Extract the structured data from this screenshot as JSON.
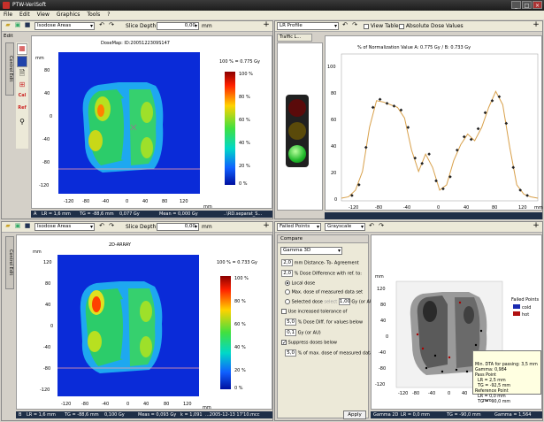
{
  "app": {
    "title": "PTW-VeriSoft"
  },
  "menu": [
    "File",
    "Edit",
    "View",
    "Graphics",
    "Tools",
    "?"
  ],
  "top_left": {
    "mode_select": "Isodose Areas",
    "slice_depth_label": "Slice Depth",
    "slice_depth_value": "0,00",
    "slice_depth_unit": "mm",
    "side_label": "Edit",
    "side_tab": "Control Edit",
    "plot_title": "DoseMap: ID:2005122309S147",
    "y_label": "mm",
    "x_label": "mm",
    "x_ticks": [
      "-120",
      "-80",
      "-40",
      "0",
      "40",
      "80",
      "120"
    ],
    "y_ticks": [
      "80",
      "40",
      "0",
      "-40",
      "-80",
      "-120"
    ],
    "colorbar_header": "100 % = 0.775 Gy",
    "colorbar_ticks": [
      "100 %",
      "80 %",
      "60 %",
      "40 %",
      "20 %",
      "0 %"
    ],
    "status": {
      "a": "A",
      "lr": "LR = 1,6 mm",
      "tg": "TG = -88,6 mm",
      "dose": "0,077 Gy",
      "mean": "Mean = 0,000 Gy",
      "file": "..\\RD.separat_S..."
    }
  },
  "top_right": {
    "mode_select": "LR Profile",
    "view_table": "View Table",
    "absolute": "Absolute Dose Values",
    "traffic_label": "Traffic L...",
    "plot_title": "% of Normalization Value A: 0.775 Gy / B: 0.733 Gy",
    "x_ticks": [
      "-120",
      "-80",
      "-40",
      "0",
      "40",
      "80",
      "120"
    ],
    "y_ticks": [
      "100",
      "80",
      "60",
      "40",
      "20",
      "0"
    ],
    "x_label": "mm"
  },
  "bottom_left": {
    "mode_select": "Isodose Areas",
    "slice_depth_label": "Slice Depth",
    "slice_depth_value": "0,00",
    "slice_depth_unit": "mm",
    "side_tab": "Control Edit",
    "plot_title": "2D-ARRAY",
    "y_label": "mm",
    "x_label": "mm",
    "x_ticks": [
      "-120",
      "-80",
      "-40",
      "0",
      "40",
      "80",
      "120"
    ],
    "y_ticks": [
      "120",
      "80",
      "40",
      "0",
      "-40",
      "-80",
      "-120"
    ],
    "colorbar_header": "100 % = 0.733 Gy",
    "colorbar_ticks": [
      "100 %",
      "80 %",
      "60 %",
      "40 %",
      "20 %",
      "0 %"
    ],
    "status": {
      "b": "B",
      "lr": "LR = 1,6 mm",
      "tg": "TG = -88,6 mm",
      "dose": "0,100 Gy",
      "meas": "Meas = 0,093 Gy",
      "k": "k = 1,091",
      "file": "...2005-12-13 17'10.mcc"
    }
  },
  "bottom_right": {
    "mode_select": "Failed Points",
    "scale_select": "Grayscale",
    "compare_tab": "Compare",
    "method": "Gamma 3D",
    "distance_value": "2,0",
    "distance_label": "mm Distance- To- Agreement",
    "dose_diff_value": "2,0",
    "dose_diff_label": "% Dose Difference with ref. to:",
    "local_dose": "Local dose",
    "max_dose": "Max. dose of measured data set",
    "selected_dose": "Selected dose",
    "select_btn": "select",
    "selected_value": "1,00",
    "selected_unit": "Gy (or AU)",
    "increased_tol": "Use increased tolerance of",
    "inc_pct_value": "5,0",
    "inc_pct_label": "% Dose Diff. for values below",
    "inc_gy_value": "0,1",
    "inc_gy_label": "Gy (or AU)",
    "suppress": "Suppress doses below",
    "suppress_value": "5,0",
    "suppress_label": "% of max. dose of measured data set",
    "apply": "Apply",
    "legend_title": "Failed Points",
    "legend_cold": "cold",
    "legend_hot": "hot",
    "y_label": "mm",
    "x_label": "mm",
    "x_ticks": [
      "-120",
      "-80",
      "-40",
      "0",
      "40",
      "80",
      "120"
    ],
    "y_ticks": [
      "120",
      "80",
      "40",
      "0",
      "-40",
      "-80",
      "-120"
    ],
    "tooltip": [
      "Min. DTA for passing: 3,5 mm",
      "Gamma: 0,984",
      "Pass Point",
      "  LR = 2,5 mm",
      "  TG = -92,5 mm",
      "Reference Point",
      "  LR = 0,0 mm",
      "  TG = -90,0 mm"
    ],
    "status": {
      "g": "Gamma 2D",
      "lr": "LR = 0,0 mm",
      "tg": "TG = -90,0 mm",
      "gamma": "Gamma = 1,564"
    }
  },
  "chart_data": {
    "type": "line",
    "title": "% of Normalization Value A: 0.775 Gy / B: 0.733 Gy",
    "xlabel": "mm",
    "ylabel": "",
    "xlim": [
      -140,
      140
    ],
    "ylim": [
      0,
      110
    ],
    "series": [
      {
        "x": [
          -140,
          -130,
          -120,
          -110,
          -100,
          -90,
          -80,
          -70,
          -60,
          -50,
          -40,
          -30,
          -20,
          -10,
          0,
          10,
          20,
          30,
          40,
          50,
          60,
          70,
          80,
          90,
          100,
          110,
          120,
          130,
          140
        ],
        "values": [
          2,
          3,
          8,
          22,
          55,
          75,
          74,
          72,
          70,
          62,
          38,
          22,
          35,
          25,
          8,
          12,
          30,
          42,
          50,
          45,
          55,
          70,
          82,
          72,
          40,
          12,
          5,
          3,
          2
        ]
      },
      {
        "x": [
          -125,
          -115,
          -105,
          -95,
          -85,
          -75,
          -65,
          -55,
          -45,
          -35,
          -25,
          -15,
          -5,
          5,
          15,
          25,
          35,
          45,
          55,
          65,
          75,
          85,
          95,
          105,
          115,
          125
        ],
        "values": [
          4,
          12,
          40,
          70,
          76,
          73,
          71,
          68,
          55,
          32,
          28,
          35,
          15,
          9,
          18,
          38,
          48,
          46,
          54,
          66,
          75,
          78,
          58,
          25,
          8,
          4
        ]
      }
    ]
  }
}
